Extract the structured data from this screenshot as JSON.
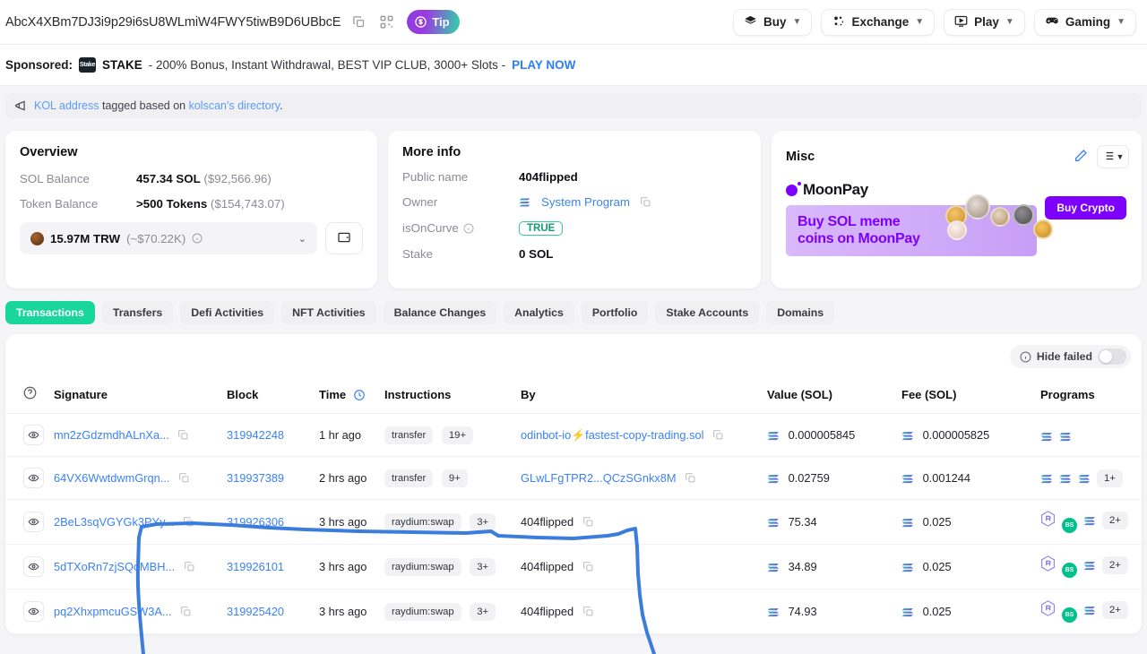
{
  "header": {
    "address": "AbcX4XBm7DJ3i9p29i6sU8WLmiW4FWY5tiwB9D6UBbcE",
    "copy_icon": "copy-icon",
    "qr_icon": "qr-code-icon",
    "tip_label": "Tip",
    "nav": [
      {
        "label": "Buy",
        "icon": "buy-icon"
      },
      {
        "label": "Exchange",
        "icon": "exchange-icon"
      },
      {
        "label": "Play",
        "icon": "play-icon"
      },
      {
        "label": "Gaming",
        "icon": "gaming-icon"
      }
    ]
  },
  "sponsored": {
    "label": "Sponsored:",
    "brand": "STAKE",
    "brand_logo_text": "Stake",
    "text": "- 200% Bonus, Instant Withdrawal, BEST VIP CLUB, 3000+ Slots -",
    "cta": "PLAY NOW"
  },
  "kol_notice": {
    "icon": "megaphone-icon",
    "link1": "KOL address",
    "middle": " tagged based on ",
    "link2": "kolscan's directory",
    "period": "."
  },
  "overview": {
    "title": "Overview",
    "rows": [
      {
        "key": "SOL Balance",
        "value": "457.34 SOL",
        "sub": "($92,566.96)"
      },
      {
        "key": "Token Balance",
        "value": ">500 Tokens",
        "sub": "($154,743.07)"
      }
    ],
    "token_selector": {
      "amount": "15.97M TRW",
      "usd": "(~$70.22K)",
      "info_icon": "info-icon",
      "chevron": "chevron-down-icon"
    },
    "wallet_icon": "wallet-icon"
  },
  "more_info": {
    "title": "More info",
    "rows": [
      {
        "key": "Public name",
        "value": "404flipped",
        "type": "bold"
      },
      {
        "key": "Owner",
        "value": "System Program",
        "type": "link"
      },
      {
        "key": "isOnCurve",
        "value": "TRUE",
        "type": "pill"
      },
      {
        "key": "Stake",
        "value": "0 SOL",
        "type": "bold"
      }
    ]
  },
  "misc": {
    "title": "Misc",
    "edit_icon": "pencil-icon",
    "list_icon": "list-icon",
    "banner": {
      "brand": "MoonPay",
      "headline_line1": "Buy SOL meme",
      "headline_line2": "coins on MoonPay",
      "cta": "Buy Crypto"
    }
  },
  "tabs": [
    {
      "label": "Transactions",
      "active": true
    },
    {
      "label": "Transfers",
      "active": false
    },
    {
      "label": "Defi Activities",
      "active": false
    },
    {
      "label": "NFT Activities",
      "active": false
    },
    {
      "label": "Balance Changes",
      "active": false
    },
    {
      "label": "Analytics",
      "active": false
    },
    {
      "label": "Portfolio",
      "active": false
    },
    {
      "label": "Stake Accounts",
      "active": false
    },
    {
      "label": "Domains",
      "active": false
    }
  ],
  "table": {
    "hide_failed_label": "Hide failed",
    "hide_failed_on": false,
    "columns": [
      "",
      "Signature",
      "Block",
      "Time",
      "Instructions",
      "By",
      "Value (SOL)",
      "Fee (SOL)",
      "Programs"
    ],
    "rows": [
      {
        "signature": "mn2zGdzmdhALnXa...",
        "block": "319942248",
        "time": "1 hr ago",
        "instruction": "transfer",
        "instruction_more": "19+",
        "by": "odinbot-io⚡fastest-copy-trading.sol",
        "by_is_link": true,
        "value": "0.000005845",
        "fee": "0.000005825",
        "programs": [
          "sol",
          "sol"
        ],
        "programs_more": ""
      },
      {
        "signature": "64VX6WwtdwmGrqn...",
        "block": "319937389",
        "time": "2 hrs ago",
        "instruction": "transfer",
        "instruction_more": "9+",
        "by": "GLwLFgTPR2...QCzSGnkx8M",
        "by_is_link": true,
        "value": "0.02759",
        "fee": "0.001244",
        "programs": [
          "sol",
          "sol",
          "sol"
        ],
        "programs_more": "1+"
      },
      {
        "signature": "2BeL3sqVGYGk3PYy...",
        "block": "319926306",
        "time": "3 hrs ago",
        "instruction": "raydium:swap",
        "instruction_more": "3+",
        "by": "404flipped",
        "by_is_link": false,
        "value": "75.34",
        "fee": "0.025",
        "programs": [
          "raydium",
          "bs",
          "sol"
        ],
        "programs_more": "2+"
      },
      {
        "signature": "5dTXoRn7zjSQoMBH...",
        "block": "319926101",
        "time": "3 hrs ago",
        "instruction": "raydium:swap",
        "instruction_more": "3+",
        "by": "404flipped",
        "by_is_link": false,
        "value": "34.89",
        "fee": "0.025",
        "programs": [
          "raydium",
          "bs",
          "sol"
        ],
        "programs_more": "2+"
      },
      {
        "signature": "pq2XhxpmcuGSW3A...",
        "block": "319925420",
        "time": "3 hrs ago",
        "instruction": "raydium:swap",
        "instruction_more": "3+",
        "by": "404flipped",
        "by_is_link": false,
        "value": "74.93",
        "fee": "0.025",
        "programs": [
          "raydium",
          "bs",
          "sol"
        ],
        "programs_more": "2+"
      }
    ]
  },
  "annotation": {
    "color": "#3b7ddd",
    "shape": "hand-drawn-bracket"
  }
}
